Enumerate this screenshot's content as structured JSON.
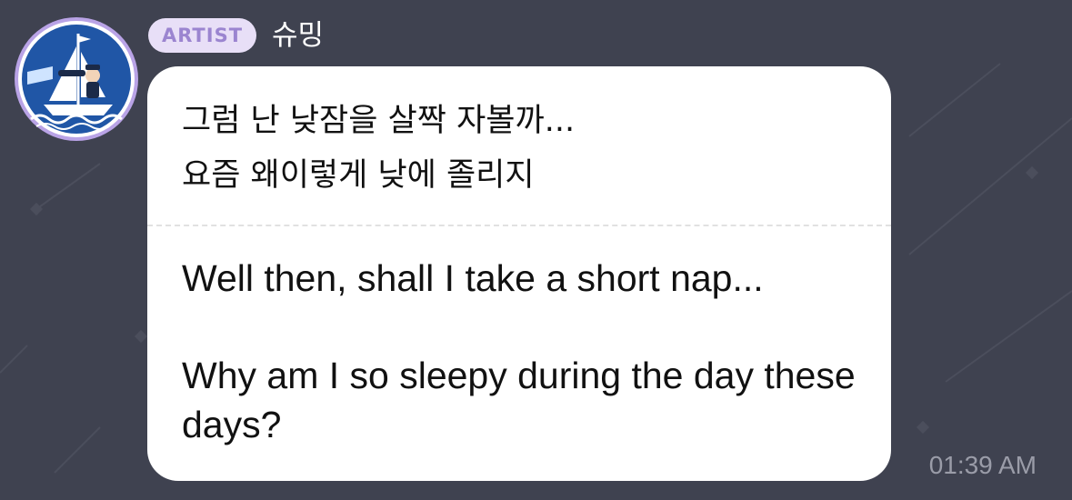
{
  "message": {
    "badge_label": "ARTIST",
    "username": "슈밍",
    "original_text": "그럼 난 낮잠을 살짝 자볼까...\n요즘 왜이렇게 낮에 졸리지",
    "translated_lines": [
      "Well then, shall I take a short nap...",
      "Why am I so sleepy during the day these days?"
    ],
    "timestamp": "01:39 AM"
  },
  "colors": {
    "background": "#3f4250",
    "badge_bg": "#e8dff7",
    "badge_text": "#9b85d0",
    "avatar_ring": "#b9a3e6",
    "avatar_blue": "#2056a6",
    "bubble": "#ffffff",
    "timestamp": "#9a9ca8"
  },
  "icons": {
    "avatar": "ship-sailor-logo-icon"
  }
}
